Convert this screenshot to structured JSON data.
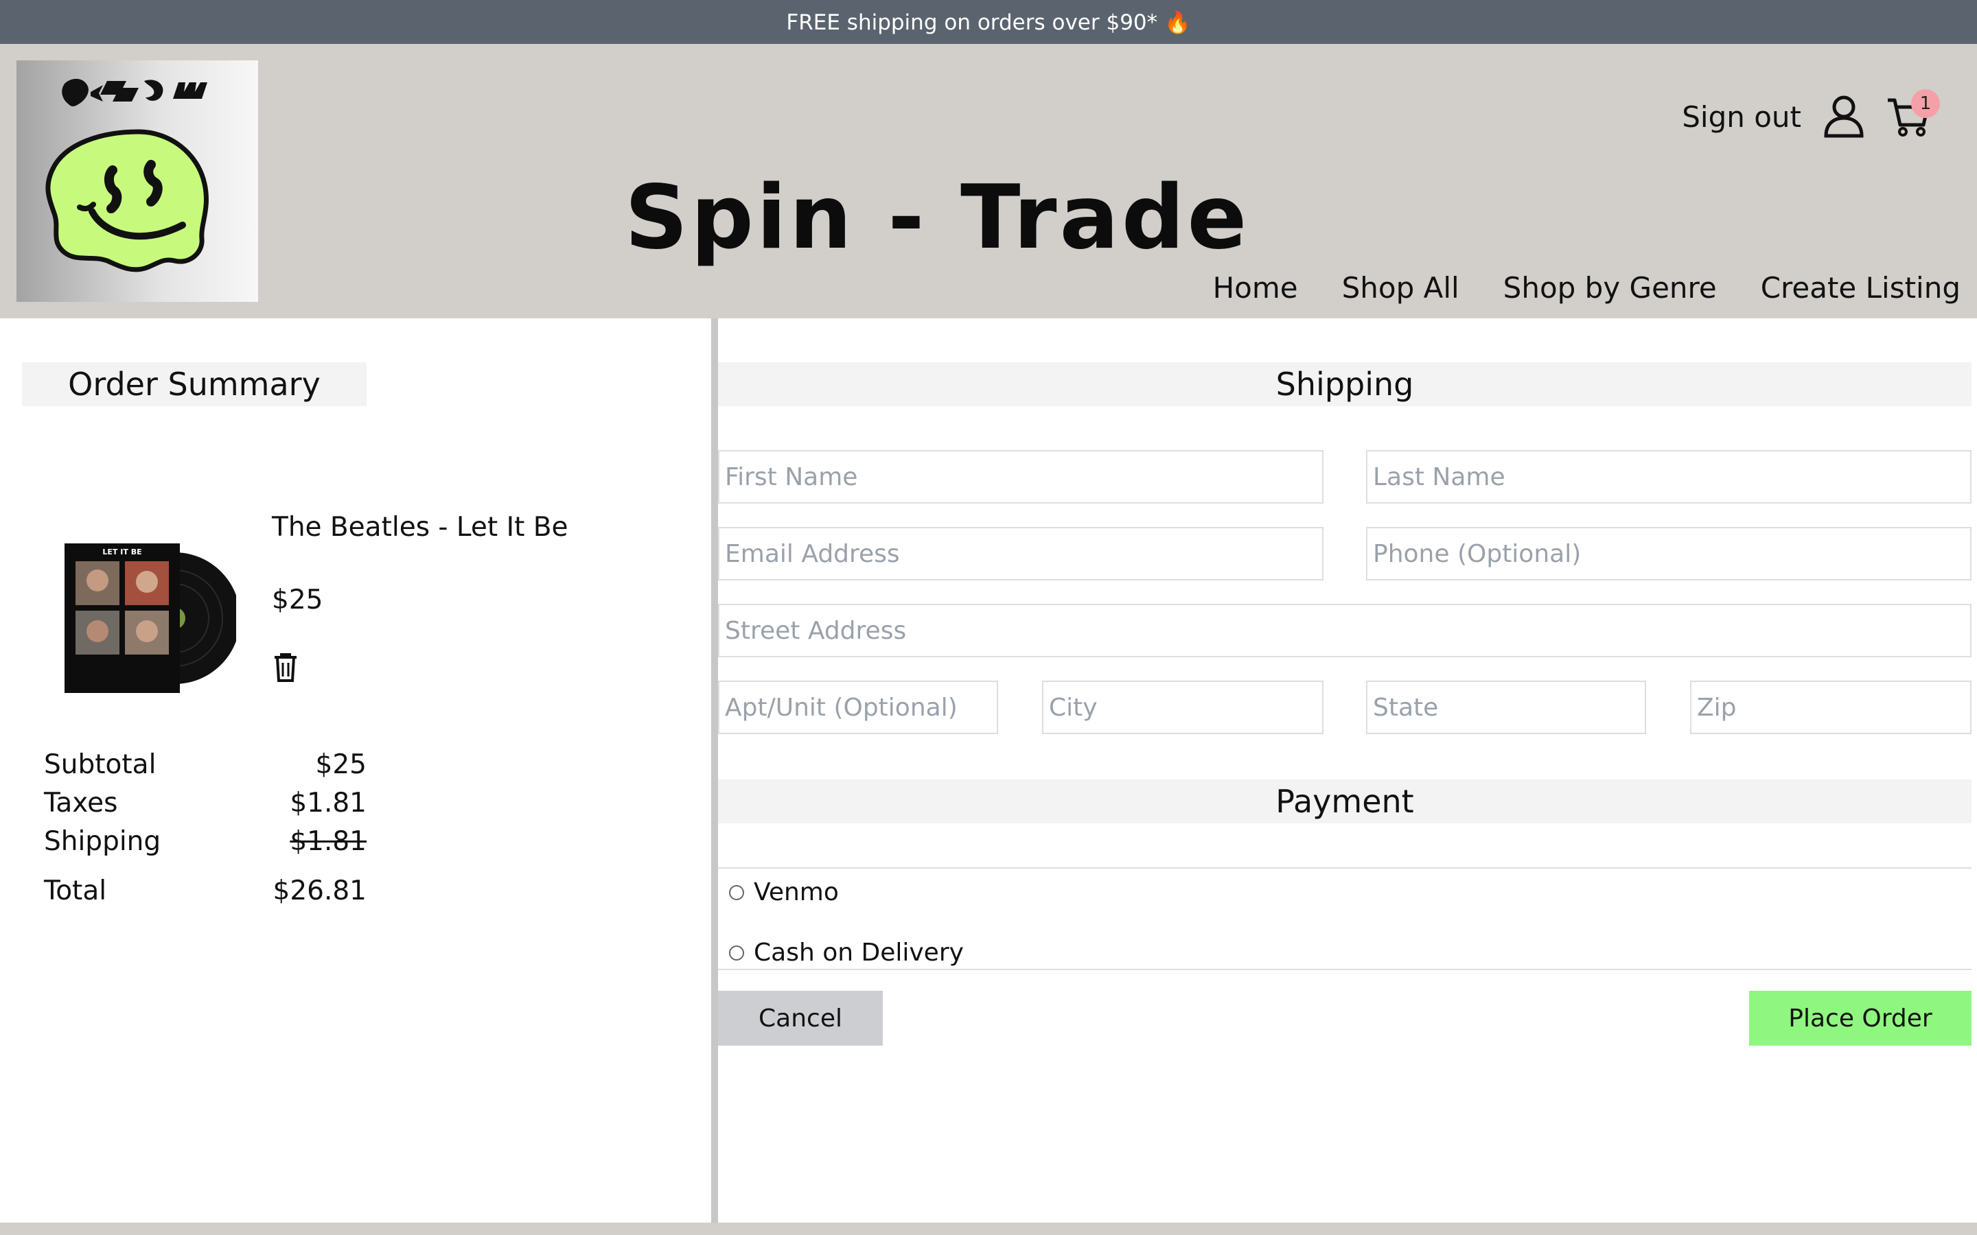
{
  "banner": {
    "text": "FREE shipping on orders over $90* 🔥"
  },
  "brand": {
    "title": "Spin - Trade",
    "logo_mark_color": "#c7fa7c"
  },
  "account": {
    "sign_out": "Sign out",
    "cart_count": "1"
  },
  "nav": {
    "items": [
      {
        "label": "Home"
      },
      {
        "label": "Shop All"
      },
      {
        "label": "Shop by Genre"
      },
      {
        "label": "Create Listing"
      }
    ]
  },
  "order_summary": {
    "heading": "Order Summary",
    "item": {
      "name": "The Beatles - Let It Be",
      "price": "$25",
      "cover_text": "LET IT BE"
    },
    "rows": [
      {
        "label": "Subtotal",
        "value": "$25",
        "strike": false
      },
      {
        "label": "Taxes",
        "value": "$1.81",
        "strike": false
      },
      {
        "label": "Shipping",
        "value": "$1.81",
        "strike": true
      }
    ],
    "total": {
      "label": "Total",
      "value": "$26.81"
    }
  },
  "shipping": {
    "heading": "Shipping",
    "fields": {
      "first_name": "First Name",
      "last_name": "Last Name",
      "email": "Email Address",
      "phone": "Phone (Optional)",
      "street": "Street Address",
      "apt": "Apt/Unit (Optional)",
      "city": "City",
      "state": "State",
      "zip": "Zip"
    }
  },
  "payment": {
    "heading": "Payment",
    "options": [
      {
        "label": "Venmo",
        "selected": false
      },
      {
        "label": "Cash on Delivery",
        "selected": false
      }
    ]
  },
  "actions": {
    "cancel": "Cancel",
    "place_order": "Place Order",
    "place_order_color": "#8ff77f"
  }
}
